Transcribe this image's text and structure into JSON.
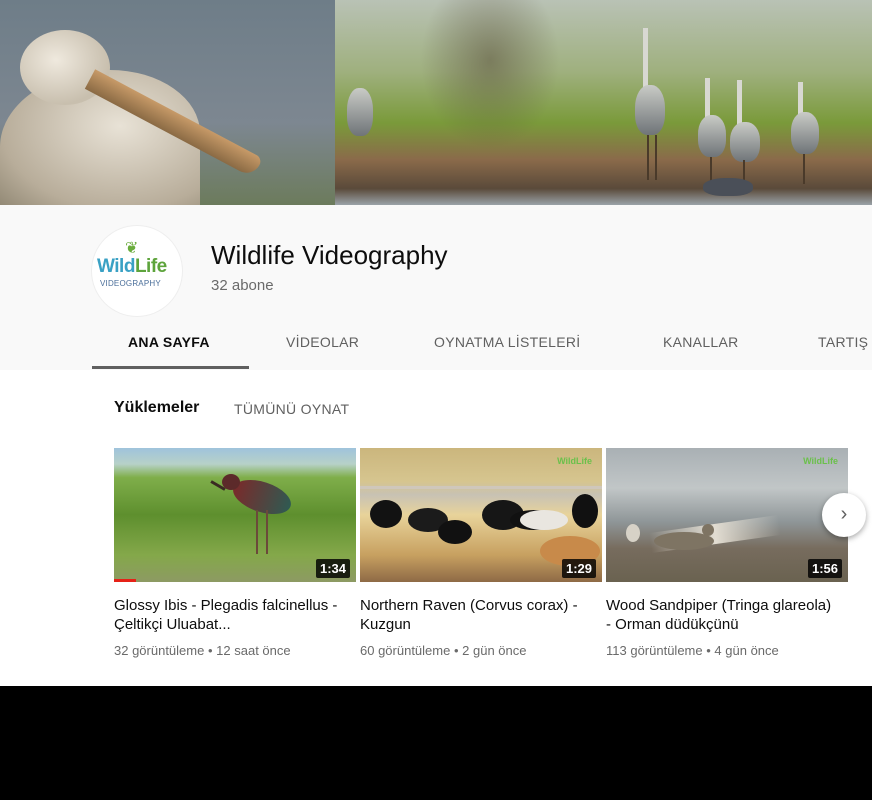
{
  "channel": {
    "name": "Wildlife Videography",
    "subscribers": "32 abone",
    "logo": {
      "word1": "Wild",
      "word2": "Life",
      "subtitle": "VIDEOGRAPHY"
    }
  },
  "tabs": [
    {
      "label": "ANA SAYFA",
      "active": true
    },
    {
      "label": "VİDEOLAR"
    },
    {
      "label": "OYNATMA LİSTELERİ"
    },
    {
      "label": "KANALLAR"
    },
    {
      "label": "TARTIŞ"
    }
  ],
  "section": {
    "title": "Yüklemeler",
    "play_all": "TÜMÜNÜ OYNAT"
  },
  "videos": [
    {
      "title": "Glossy Ibis - Plegadis falcinellus - Çeltikçi Uluabat...",
      "duration": "1:34",
      "views": "32 görüntüleme",
      "age": "12 saat önce",
      "watched_fraction": 0.09
    },
    {
      "title": "Northern Raven (Corvus corax) - Kuzgun",
      "duration": "1:29",
      "views": "60 görüntüleme",
      "age": "2 gün önce"
    },
    {
      "title": "Wood Sandpiper (Tringa glareola) - Orman düdükçünü",
      "duration": "1:56",
      "views": "113 görüntüleme",
      "age": "4 gün önce"
    }
  ],
  "separator": "•",
  "icons": {
    "next": "chevron-right-icon"
  },
  "colors": {
    "progress": "#e62117",
    "text_primary": "#0d0d0d",
    "text_secondary": "#6a6a6a"
  }
}
